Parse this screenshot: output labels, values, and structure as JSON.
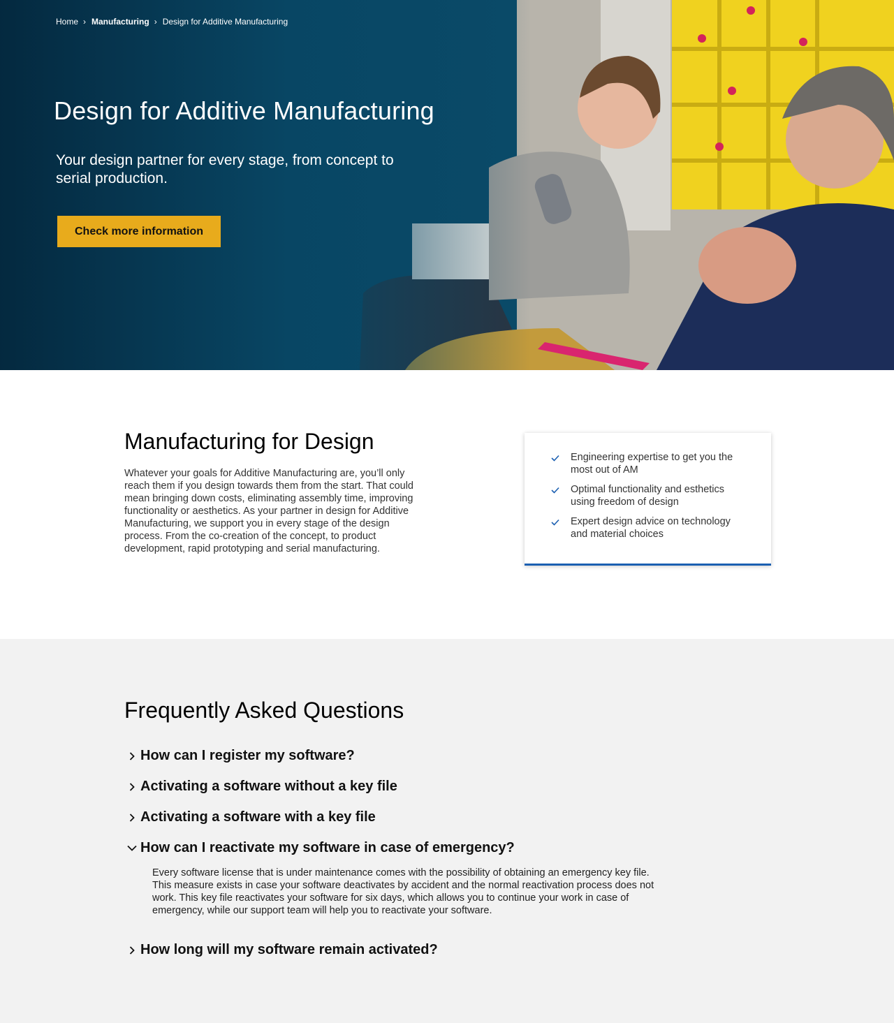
{
  "breadcrumb": {
    "items": [
      "Home",
      "Manufacturing",
      "Design for Additive Manufacturing"
    ]
  },
  "hero": {
    "title": "Design for Additive Manufacturing",
    "subtitle": "Your design partner for every stage, from concept to serial production.",
    "cta_label": "Check more information"
  },
  "intro": {
    "title": "Manufacturing for Design",
    "body": "Whatever your goals for Additive Manufacturing are, you’ll only reach them if you design towards them from the start. That could mean bringing down costs, eliminating assembly time, improving functionality or aesthetics. As your partner in design for Additive Manufacturing, we support you in every stage of the design process. From the co-creation of the concept, to product development, rapid prototyping and serial manufacturing.",
    "benefits": [
      "Engineering expertise to get you the most out of AM",
      "Optimal functionality and esthetics using freedom of design",
      "Expert design advice on technology and material choices"
    ]
  },
  "faq": {
    "title": "Frequently Asked Questions",
    "items": [
      {
        "question": "How can I register my software?",
        "expanded": false
      },
      {
        "question": "Activating a software without a key file",
        "expanded": false
      },
      {
        "question": "Activating a software with a key file",
        "expanded": false
      },
      {
        "question": "How can I reactivate my software in case of emergency?",
        "expanded": true,
        "answer": "Every software license that is under maintenance comes with the possibility of obtaining an emergency key file. This measure exists in case your software deactivates by accident and the normal reactivation process does not work. This key file reactivates your software for six days, which allows you to continue your work in case of emergency, while our support team will help you to reactivate your software."
      },
      {
        "question": "How long will my software remain activated?",
        "expanded": false
      }
    ]
  },
  "colors": {
    "accent_yellow": "#e8ab1c",
    "accent_blue": "#1b5fb1",
    "hero_dark": "#05293f",
    "faq_background": "#f2f2f2"
  },
  "icons": {
    "breadcrumb_separator": "chevron-right-icon",
    "benefit_bullet": "check-icon",
    "faq_collapsed": "chevron-right-icon",
    "faq_expanded": "chevron-down-icon"
  }
}
